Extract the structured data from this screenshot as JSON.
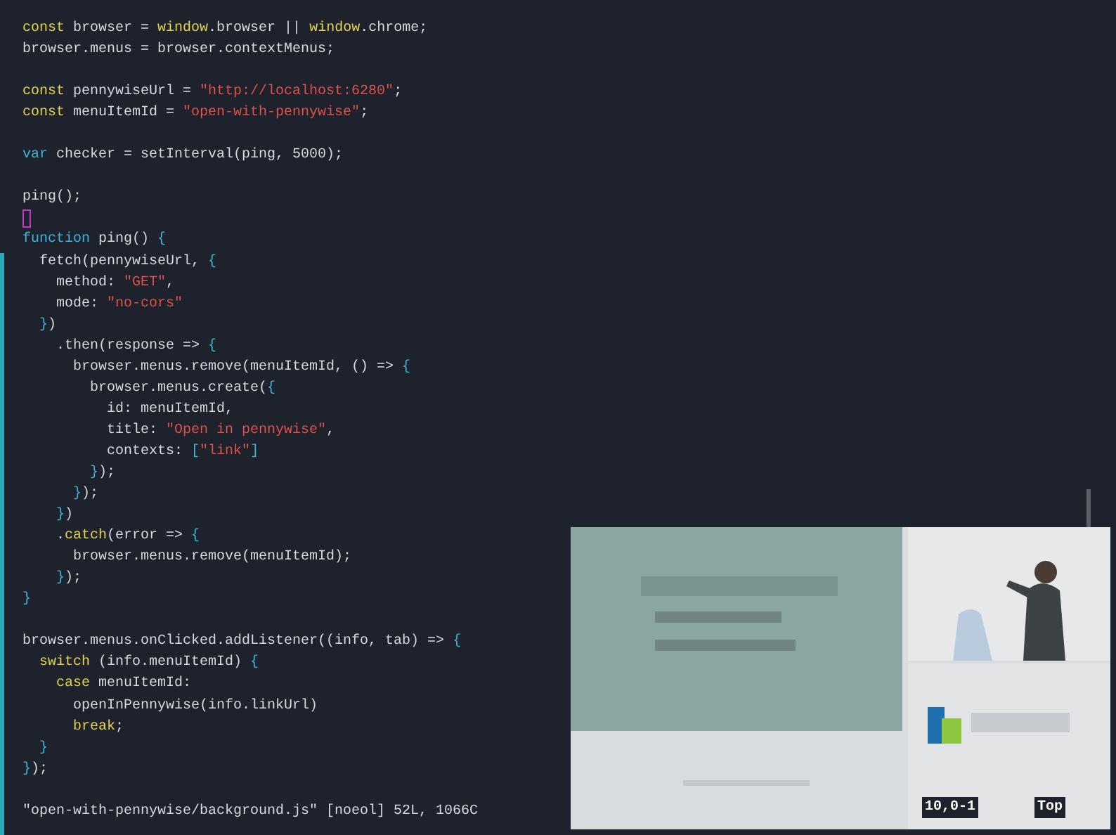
{
  "editor": {
    "lines": [
      {
        "kind": "code",
        "segments": [
          {
            "kind": "kw",
            "text": "const"
          },
          {
            "kind": "plain",
            "text": " browser = "
          },
          {
            "kind": "kw",
            "text": "window"
          },
          {
            "kind": "plain",
            "text": ".browser || "
          },
          {
            "kind": "kw",
            "text": "window"
          },
          {
            "kind": "plain",
            "text": ".chrome;"
          }
        ]
      },
      {
        "kind": "code",
        "segments": [
          {
            "kind": "plain",
            "text": "browser.menus = browser.contextMenus;"
          }
        ]
      },
      {
        "kind": "blank"
      },
      {
        "kind": "code",
        "segments": [
          {
            "kind": "kw",
            "text": "const"
          },
          {
            "kind": "plain",
            "text": " pennywiseUrl = "
          },
          {
            "kind": "str",
            "text": "\"http://localhost:6280\""
          },
          {
            "kind": "plain",
            "text": ";"
          }
        ]
      },
      {
        "kind": "code",
        "segments": [
          {
            "kind": "kw",
            "text": "const"
          },
          {
            "kind": "plain",
            "text": " menuItemId = "
          },
          {
            "kind": "str",
            "text": "\"open-with-pennywise\""
          },
          {
            "kind": "plain",
            "text": ";"
          }
        ]
      },
      {
        "kind": "blank"
      },
      {
        "kind": "code",
        "segments": [
          {
            "kind": "decl",
            "text": "var"
          },
          {
            "kind": "plain",
            "text": " checker = setInterval(ping, 5000);"
          }
        ]
      },
      {
        "kind": "blank"
      },
      {
        "kind": "code",
        "segments": [
          {
            "kind": "plain",
            "text": "ping();"
          }
        ]
      },
      {
        "kind": "cursor"
      },
      {
        "kind": "code",
        "segments": [
          {
            "kind": "decl",
            "text": "function"
          },
          {
            "kind": "plain",
            "text": " ping() "
          },
          {
            "kind": "brace",
            "text": "{"
          }
        ]
      },
      {
        "kind": "code",
        "segments": [
          {
            "kind": "plain",
            "text": "  fetch(pennywiseUrl, "
          },
          {
            "kind": "brace",
            "text": "{"
          }
        ]
      },
      {
        "kind": "code",
        "segments": [
          {
            "kind": "plain",
            "text": "    method: "
          },
          {
            "kind": "str",
            "text": "\"GET\""
          },
          {
            "kind": "plain",
            "text": ","
          }
        ]
      },
      {
        "kind": "code",
        "segments": [
          {
            "kind": "plain",
            "text": "    mode: "
          },
          {
            "kind": "str",
            "text": "\"no-cors\""
          }
        ]
      },
      {
        "kind": "code",
        "segments": [
          {
            "kind": "brace",
            "text": "  }"
          },
          {
            "kind": "plain",
            "text": ")"
          }
        ]
      },
      {
        "kind": "code",
        "segments": [
          {
            "kind": "plain",
            "text": "    .then(response => "
          },
          {
            "kind": "brace",
            "text": "{"
          }
        ]
      },
      {
        "kind": "code",
        "segments": [
          {
            "kind": "plain",
            "text": "      browser.menus.remove(menuItemId, () => "
          },
          {
            "kind": "brace",
            "text": "{"
          }
        ]
      },
      {
        "kind": "code",
        "segments": [
          {
            "kind": "plain",
            "text": "        browser.menus.create("
          },
          {
            "kind": "brace",
            "text": "{"
          }
        ]
      },
      {
        "kind": "code",
        "segments": [
          {
            "kind": "plain",
            "text": "          id: menuItemId,"
          }
        ]
      },
      {
        "kind": "code",
        "segments": [
          {
            "kind": "plain",
            "text": "          title: "
          },
          {
            "kind": "str",
            "text": "\"Open in pennywise\""
          },
          {
            "kind": "plain",
            "text": ","
          }
        ]
      },
      {
        "kind": "code",
        "segments": [
          {
            "kind": "plain",
            "text": "          contexts: "
          },
          {
            "kind": "brace",
            "text": "["
          },
          {
            "kind": "str",
            "text": "\"link\""
          },
          {
            "kind": "brace",
            "text": "]"
          }
        ]
      },
      {
        "kind": "code",
        "segments": [
          {
            "kind": "brace",
            "text": "        }"
          },
          {
            "kind": "plain",
            "text": ");"
          }
        ]
      },
      {
        "kind": "code",
        "segments": [
          {
            "kind": "brace",
            "text": "      }"
          },
          {
            "kind": "plain",
            "text": ");"
          }
        ]
      },
      {
        "kind": "code",
        "segments": [
          {
            "kind": "brace",
            "text": "    }"
          },
          {
            "kind": "plain",
            "text": ")"
          }
        ]
      },
      {
        "kind": "code",
        "segments": [
          {
            "kind": "plain",
            "text": "    ."
          },
          {
            "kind": "kw",
            "text": "catch"
          },
          {
            "kind": "plain",
            "text": "(error => "
          },
          {
            "kind": "brace",
            "text": "{"
          }
        ]
      },
      {
        "kind": "code",
        "segments": [
          {
            "kind": "plain",
            "text": "      browser.menus.remove(menuItemId);"
          }
        ]
      },
      {
        "kind": "code",
        "segments": [
          {
            "kind": "brace",
            "text": "    }"
          },
          {
            "kind": "plain",
            "text": ");"
          }
        ]
      },
      {
        "kind": "code",
        "segments": [
          {
            "kind": "brace",
            "text": "}"
          }
        ]
      },
      {
        "kind": "blank"
      },
      {
        "kind": "code",
        "segments": [
          {
            "kind": "plain",
            "text": "browser.menus.onClicked.addListener((info, tab) => "
          },
          {
            "kind": "brace",
            "text": "{"
          }
        ]
      },
      {
        "kind": "code",
        "segments": [
          {
            "kind": "kw",
            "text": "  switch"
          },
          {
            "kind": "plain",
            "text": " (info.menuItemId) "
          },
          {
            "kind": "brace",
            "text": "{"
          }
        ]
      },
      {
        "kind": "code",
        "segments": [
          {
            "kind": "kw",
            "text": "    case"
          },
          {
            "kind": "plain",
            "text": " menuItemId:"
          }
        ]
      },
      {
        "kind": "code",
        "segments": [
          {
            "kind": "plain",
            "text": "      openInPennywise(info.linkUrl)"
          }
        ]
      },
      {
        "kind": "code",
        "segments": [
          {
            "kind": "kw",
            "text": "      break"
          },
          {
            "kind": "plain",
            "text": ";"
          }
        ]
      },
      {
        "kind": "code",
        "segments": [
          {
            "kind": "brace",
            "text": "  }"
          }
        ]
      },
      {
        "kind": "code",
        "segments": [
          {
            "kind": "brace",
            "text": "}"
          },
          {
            "kind": "plain",
            "text": ");"
          }
        ]
      }
    ],
    "message": "\"open-with-pennywise/background.js\" [noeol] 52L, 1066C",
    "ruler": {
      "position": "10,0-1",
      "scroll": "Top"
    }
  }
}
